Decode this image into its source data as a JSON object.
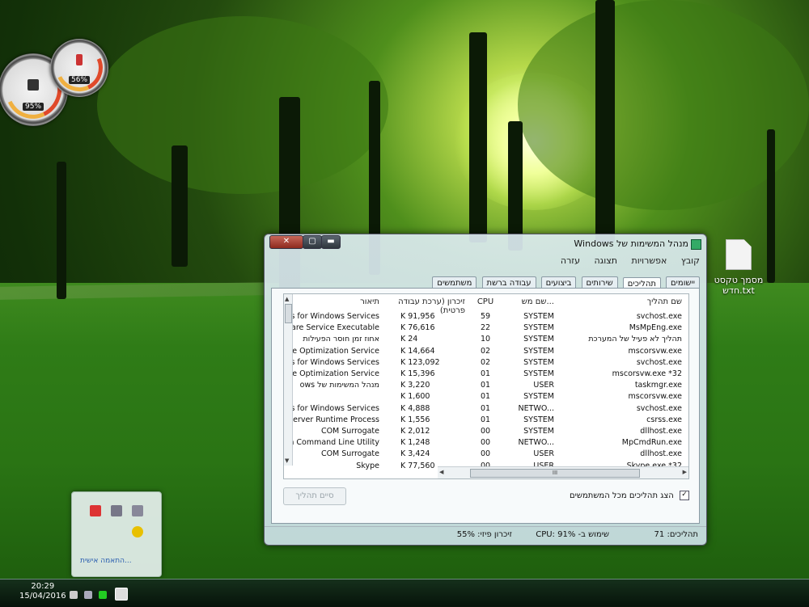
{
  "gadget": {
    "gauge_large": "95%",
    "gauge_small": "56%"
  },
  "desktop": {
    "icon_label": "מסמך טקסט חדש.txt",
    "icon_name": "text-file-icon"
  },
  "tray_popup": {
    "link": "התאמה אישית..."
  },
  "taskbar": {
    "time": "20:29",
    "date": "15/04/2016"
  },
  "window": {
    "title": "מנהל המשימות של Windows",
    "menu": [
      "קובץ",
      "אפשרויות",
      "תצוגה",
      "עזרה"
    ],
    "tabs": [
      "יישומים",
      "תהליכים",
      "שירותים",
      "ביצועים",
      "עבודה ברשת",
      "משתמשים"
    ],
    "active_tab": "תהליכים",
    "columns": {
      "name": "שם תהליך",
      "user": "שם מש...",
      "cpu": "CPU",
      "mem": "זיכרון (ערכת עבודה פרטית)",
      "desc": "תיאור"
    },
    "rows": [
      {
        "name": "svchost.exe",
        "user": "SYSTEM",
        "cpu": "59",
        "mem": "K 91,956",
        "desc": "ss for Windows Services"
      },
      {
        "name": "MsMpEng.exe",
        "user": "SYSTEM",
        "cpu": "22",
        "mem": "K 76,616",
        "desc": "ware Service Executable"
      },
      {
        "name": "תהליך לא פעיל של המערכת",
        "user": "SYSTEM",
        "cpu": "10",
        "mem": "K 24",
        "desc": "אחוז זמן חוסר הפעילות"
      },
      {
        "name": "mscorsvw.exe",
        "user": "SYSTEM",
        "cpu": "02",
        "mem": "K 14,664",
        "desc": "me Optimization Service."
      },
      {
        "name": "svchost.exe",
        "user": "SYSTEM",
        "cpu": "02",
        "mem": "K 123,092",
        "desc": "ss for Windows Services"
      },
      {
        "name": "mscorsvw.exe *32",
        "user": "SYSTEM",
        "cpu": "01",
        "mem": "K 15,396",
        "desc": "me Optimization Service."
      },
      {
        "name": "taskmgr.exe",
        "user": "USER",
        "cpu": "01",
        "mem": "K 3,220",
        "desc": "מנהל המשימות של ows"
      },
      {
        "name": "mscorsvw.exe",
        "user": "SYSTEM",
        "cpu": "01",
        "mem": "K 1,600",
        "desc": ""
      },
      {
        "name": "svchost.exe",
        "user": "NETWO...",
        "cpu": "01",
        "mem": "K 4,888",
        "desc": "ss for Windows Services"
      },
      {
        "name": "csrss.exe",
        "user": "SYSTEM",
        "cpu": "01",
        "mem": "K 1,556",
        "desc": "Server Runtime Process"
      },
      {
        "name": "dllhost.exe",
        "user": "SYSTEM",
        "cpu": "00",
        "mem": "K 2,012",
        "desc": "COM Surrogate"
      },
      {
        "name": "MpCmdRun.exe",
        "user": "NETWO...",
        "cpu": "00",
        "mem": "K 1,248",
        "desc": "tion Command Line Utility"
      },
      {
        "name": "dllhost.exe",
        "user": "USER",
        "cpu": "00",
        "mem": "K 3,424",
        "desc": "COM Surrogate"
      },
      {
        "name": "Skype.exe *32",
        "user": "USER",
        "cpu": "00",
        "mem": "K 77,560",
        "desc": "Skype"
      }
    ],
    "hscroll_grip": "III",
    "end_process": "סיים תהליך",
    "show_all": "הצג תהליכים מכל המשתמשים",
    "status": {
      "processes": "תהליכים: 71",
      "cpu": "שימוש ב- CPU: 91%",
      "mem": "זיכרון פיזי: 55%"
    }
  },
  "colors": {
    "accent": "#2a5db0",
    "close_button": "#b04434"
  }
}
